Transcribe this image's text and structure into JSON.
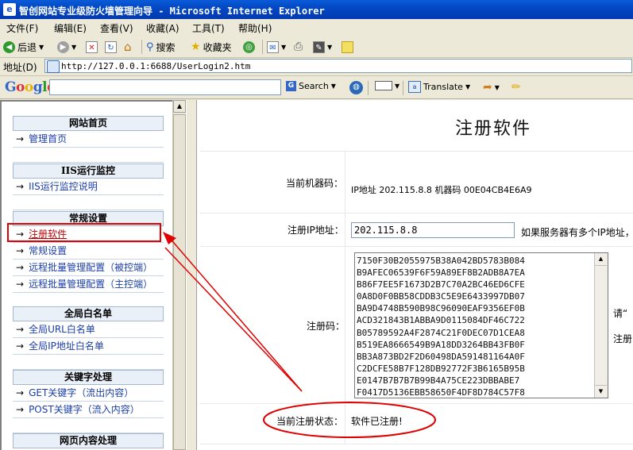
{
  "window": {
    "title": "智创网站专业级防火墙管理向导 - Microsoft Internet Explorer"
  },
  "menubar": {
    "items": [
      "文件(F)",
      "编辑(E)",
      "查看(V)",
      "收藏(A)",
      "工具(T)",
      "帮助(H)"
    ]
  },
  "toolbar": {
    "back": "后退",
    "search": "搜索",
    "favorites": "收藏夹"
  },
  "address": {
    "label": "地址(D)",
    "url": "http://127.0.0.1:6688/UserLogin2.htm"
  },
  "googlebar": {
    "logo": "Google",
    "search": "Search",
    "translate": "Translate"
  },
  "sidebar": {
    "sections": [
      {
        "title": "网站首页",
        "items": [
          "管理首页"
        ]
      },
      {
        "title": "IIS运行监控",
        "items": [
          "IIS运行监控说明"
        ]
      },
      {
        "title": "常规设置",
        "items": [
          "注册软件",
          "常规设置",
          "远程批量管理配置（被控端）",
          "远程批量管理配置（主控端）"
        ]
      },
      {
        "title": "全局白名单",
        "items": [
          "全局URL白名单",
          "全局IP地址白名单"
        ]
      },
      {
        "title": "关键字处理",
        "items": [
          "GET关键字（流出内容）",
          "POST关键字（流入内容）"
        ]
      },
      {
        "title": "网页内容处理",
        "items": []
      }
    ],
    "arrow": "→"
  },
  "main": {
    "title": "注册软件",
    "machine_label": "当前机器码：",
    "machine_value": "IP地址 202.115.8.8 机器码 00E04CB4E6A9",
    "ip_label": "注册IP地址：",
    "ip_value": "202.115.8.8",
    "ip_hint": "如果服务器有多个IP地址，",
    "code_label": "注册码：",
    "code_lines": "7150F30B2055975B38A042BD5783B084\nB9AFEC06539F6F59A89EF8B2ADB8A7EA\nB86F7EE5F1673D2B7C70A2BC46ED6CFE\n0A8D0F0BB58CDDB3C5E9E6433997DB07\nBA9D4748B590B98C96090EAF9356EF0B\nACD321843B1ABBA9D0115084DF46C722\nB05789592A4F2874C21F0DEC07D1CEA8\nB519EA8666549B9A18DD3264BB43FB0F\nBB3A873BD2F2D60498DA591481164A0F\nC2DCFE58B7F128DB92772F3B6165B95B\nE0147B7B7B7B99B4A75CE223DBBABE7\nF0417D5136EBB58650F4DF8D784C57F8",
    "code_side1": "请“",
    "code_side2": "注册",
    "status_label": "当前注册状态：",
    "status_value": "软件已注册!"
  },
  "annotation_color": "#e00000"
}
